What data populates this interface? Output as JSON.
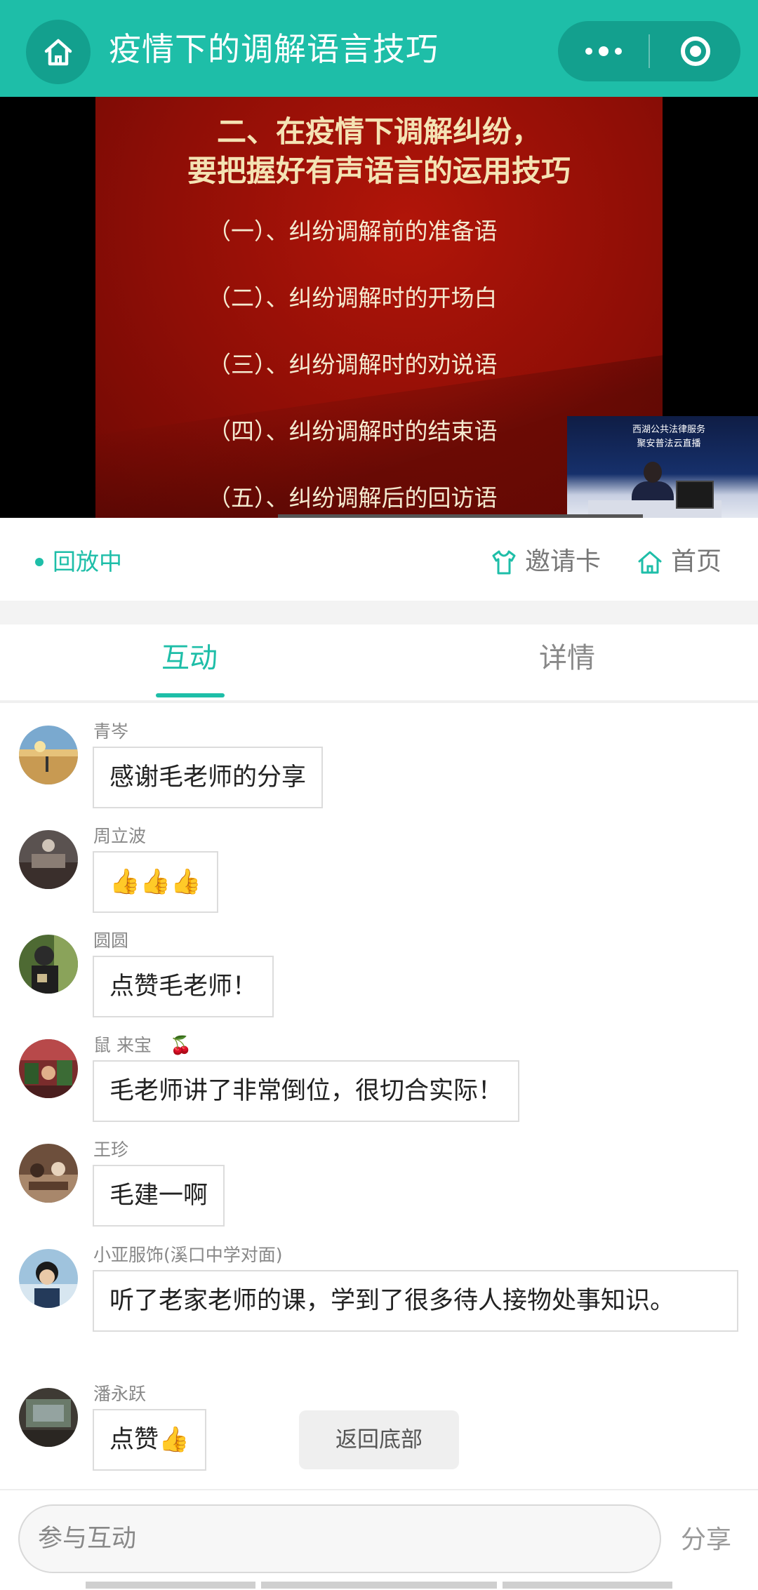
{
  "header": {
    "title": "疫情下的调解语言技巧",
    "home_icon": "home-icon",
    "more_icon": "more-dots-icon",
    "close_icon": "target-icon"
  },
  "video": {
    "slide_heading": [
      "二、在疫情下调解纠纷，",
      "要把握好有声语言的运用技巧"
    ],
    "slide_items": [
      "（一）、纠纷调解前的准备语",
      "（二）、纠纷调解时的开场白",
      "（三）、纠纷调解时的劝说语",
      "（四）、纠纷调解时的结束语",
      "（五）、纠纷调解后的回访语"
    ],
    "pip_banner": [
      "西湖公共法律服务",
      "聚安普法云直播"
    ]
  },
  "status": {
    "live_label": "回放中",
    "invite_label": "邀请卡",
    "home_label": "首页"
  },
  "tabs": {
    "interact": "互动",
    "details": "详情"
  },
  "messages": [
    {
      "name": "青岑",
      "text": "感谢毛老师的分享"
    },
    {
      "name": "周立波",
      "text": "👍👍👍"
    },
    {
      "name": "圆圆",
      "text": "点赞毛老师！"
    },
    {
      "name": "鼠 来宝",
      "badge": "🍒",
      "text": "毛老师讲了非常倒位，很切合实际！"
    },
    {
      "name": "王珍",
      "text": "毛建一啊"
    },
    {
      "name": "小亚服饰(溪口中学对面)",
      "text": "听了老家老师的课，学到了很多待人接物处事知识。"
    },
    {
      "name": "潘永跃",
      "text": "点赞👍"
    }
  ],
  "back_to_bottom": "返回底部",
  "input": {
    "placeholder": "参与互动",
    "share_label": "分享"
  },
  "colors": {
    "accent": "#1ebea8",
    "slide_red": "#9a1108"
  }
}
